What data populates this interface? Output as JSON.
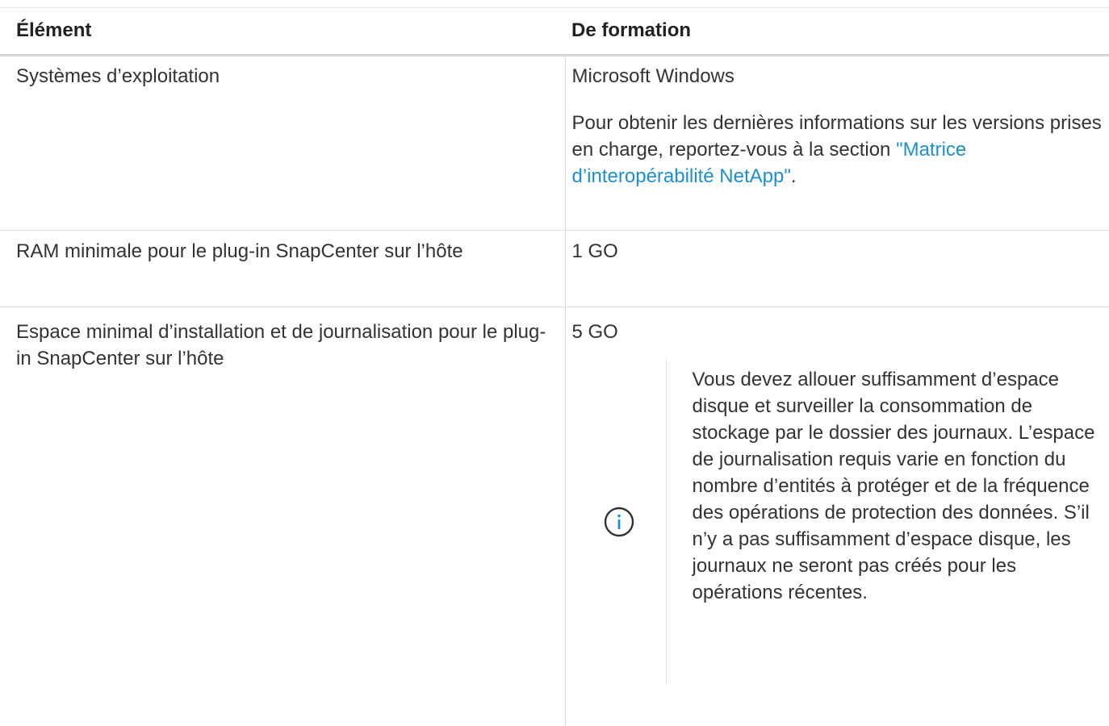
{
  "table": {
    "header": {
      "col1": "Élément",
      "col2": "De formation"
    },
    "rows": [
      {
        "item": "Systèmes d’exploitation",
        "value": "Microsoft Windows",
        "note": {
          "text": "Pour obtenir les dernières informations sur les versions prises en charge, reportez-vous à la section",
          "link": "\"Matrice d’interopérabilité NetApp\"",
          "after": "."
        }
      },
      {
        "item": "RAM minimale pour le plug-in SnapCenter sur l’hôte",
        "value": "1 GO"
      },
      {
        "item": "Espace minimal d’installation et de journalisation pour le plug-in SnapCenter sur l’hôte",
        "value": "5 GO",
        "admonition": {
          "icon": "info-icon",
          "text": "Vous devez allouer suffisamment d’espace disque et surveiller la consommation de stockage par le dossier des journaux. L’espace de journalisation requis varie en fonction du nombre d’entités à protéger et de la fréquence des opérations de protection des données. S’il n’y a pas suffisamment d’espace disque, les journaux ne seront pas créés pour les opérations récentes."
        }
      }
    ]
  },
  "colors": {
    "text": "#333333",
    "link": "#1a8fd1",
    "border": "#dddddd"
  }
}
